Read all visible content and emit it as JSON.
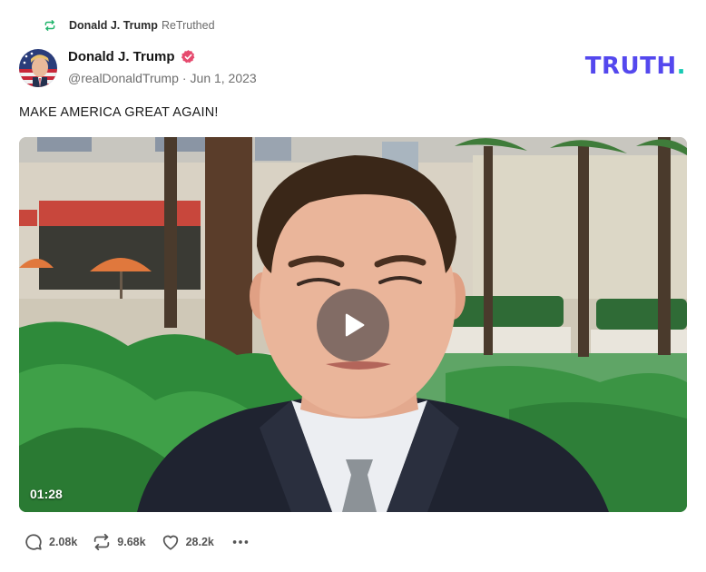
{
  "retruth": {
    "icon": "retruth-icon",
    "user_name": "Donald J. Trump",
    "action_label": "ReTruthed"
  },
  "post": {
    "author": {
      "display_name": "Donald J. Trump",
      "verified_icon": "verified-badge-icon",
      "handle": "@realDonaldTrump",
      "separator": "·",
      "date": "Jun 1, 2023"
    },
    "brand": {
      "logo_main": "TRUTH",
      "logo_dot": "."
    },
    "text": "MAKE AMERICA GREAT AGAIN!",
    "video": {
      "duration": "01:28",
      "play_icon": "play-icon"
    },
    "stats": {
      "replies": "2.08k",
      "retruths": "9.68k",
      "likes": "28.2k"
    },
    "more_icon": "more-icon"
  },
  "colors": {
    "brand_purple": "#5448ee",
    "brand_teal": "#17c9b3",
    "retruth_green": "#21b46b",
    "verified_red": "#e64a6e"
  }
}
